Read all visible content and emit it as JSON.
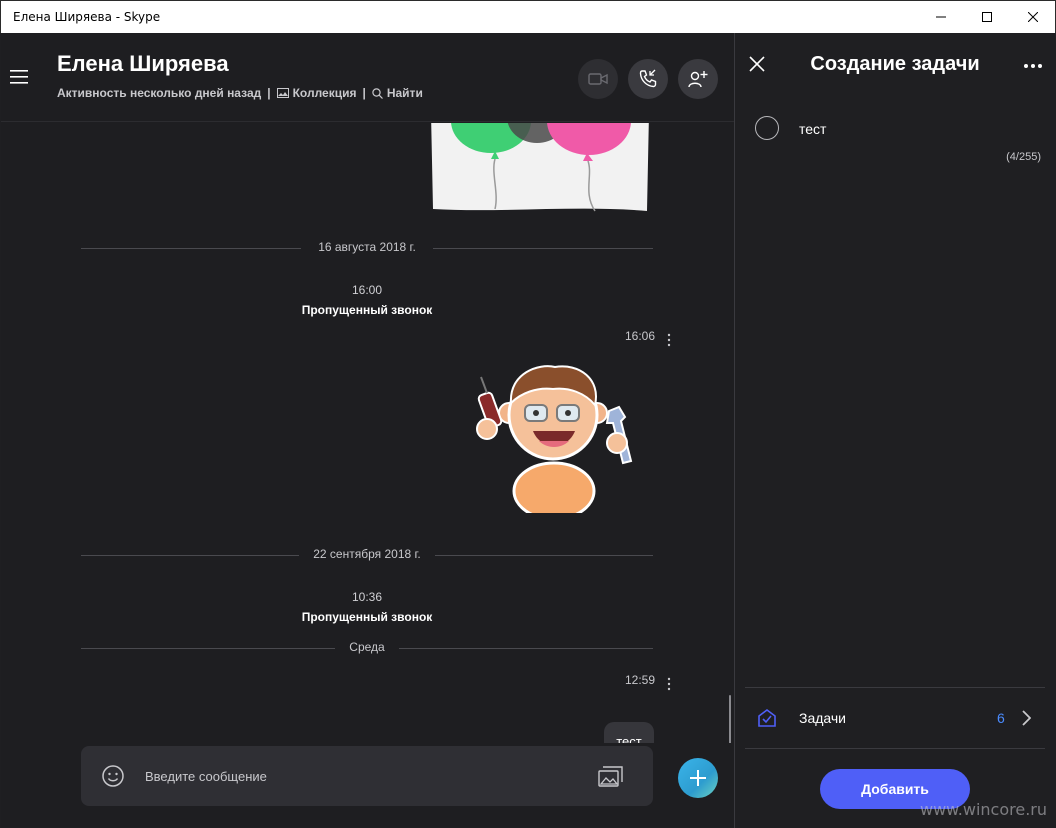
{
  "window": {
    "title": "Елена Ширяева - Skype"
  },
  "chat": {
    "contact_name": "Елена Ширяева",
    "meta": {
      "activity": "Активность несколько дней назад",
      "collection": "Коллекция",
      "find": "Найти",
      "separator": "|"
    },
    "messages": {
      "date1": "16 августа 2018 г.",
      "time1": "16:00",
      "missed1": "Пропущенный звонок",
      "sticker_time": "16:06",
      "date2": "22 сентября 2018 г.",
      "time2": "10:36",
      "missed2": "Пропущенный звонок",
      "date3": "Среда",
      "msg_time": "12:59",
      "msg_text": "тест"
    },
    "composer": {
      "placeholder": "Введите сообщение"
    }
  },
  "task_panel": {
    "title": "Создание задачи",
    "task_text": "тест",
    "char_count": "(4/255)",
    "tasks_label": "Задачи",
    "tasks_count": "6",
    "add_button": "Добавить"
  },
  "watermark": "www.wincore.ru",
  "colors": {
    "accent": "#4f5ff7",
    "count_blue": "#4a8bff",
    "background": "#1f1f22"
  }
}
